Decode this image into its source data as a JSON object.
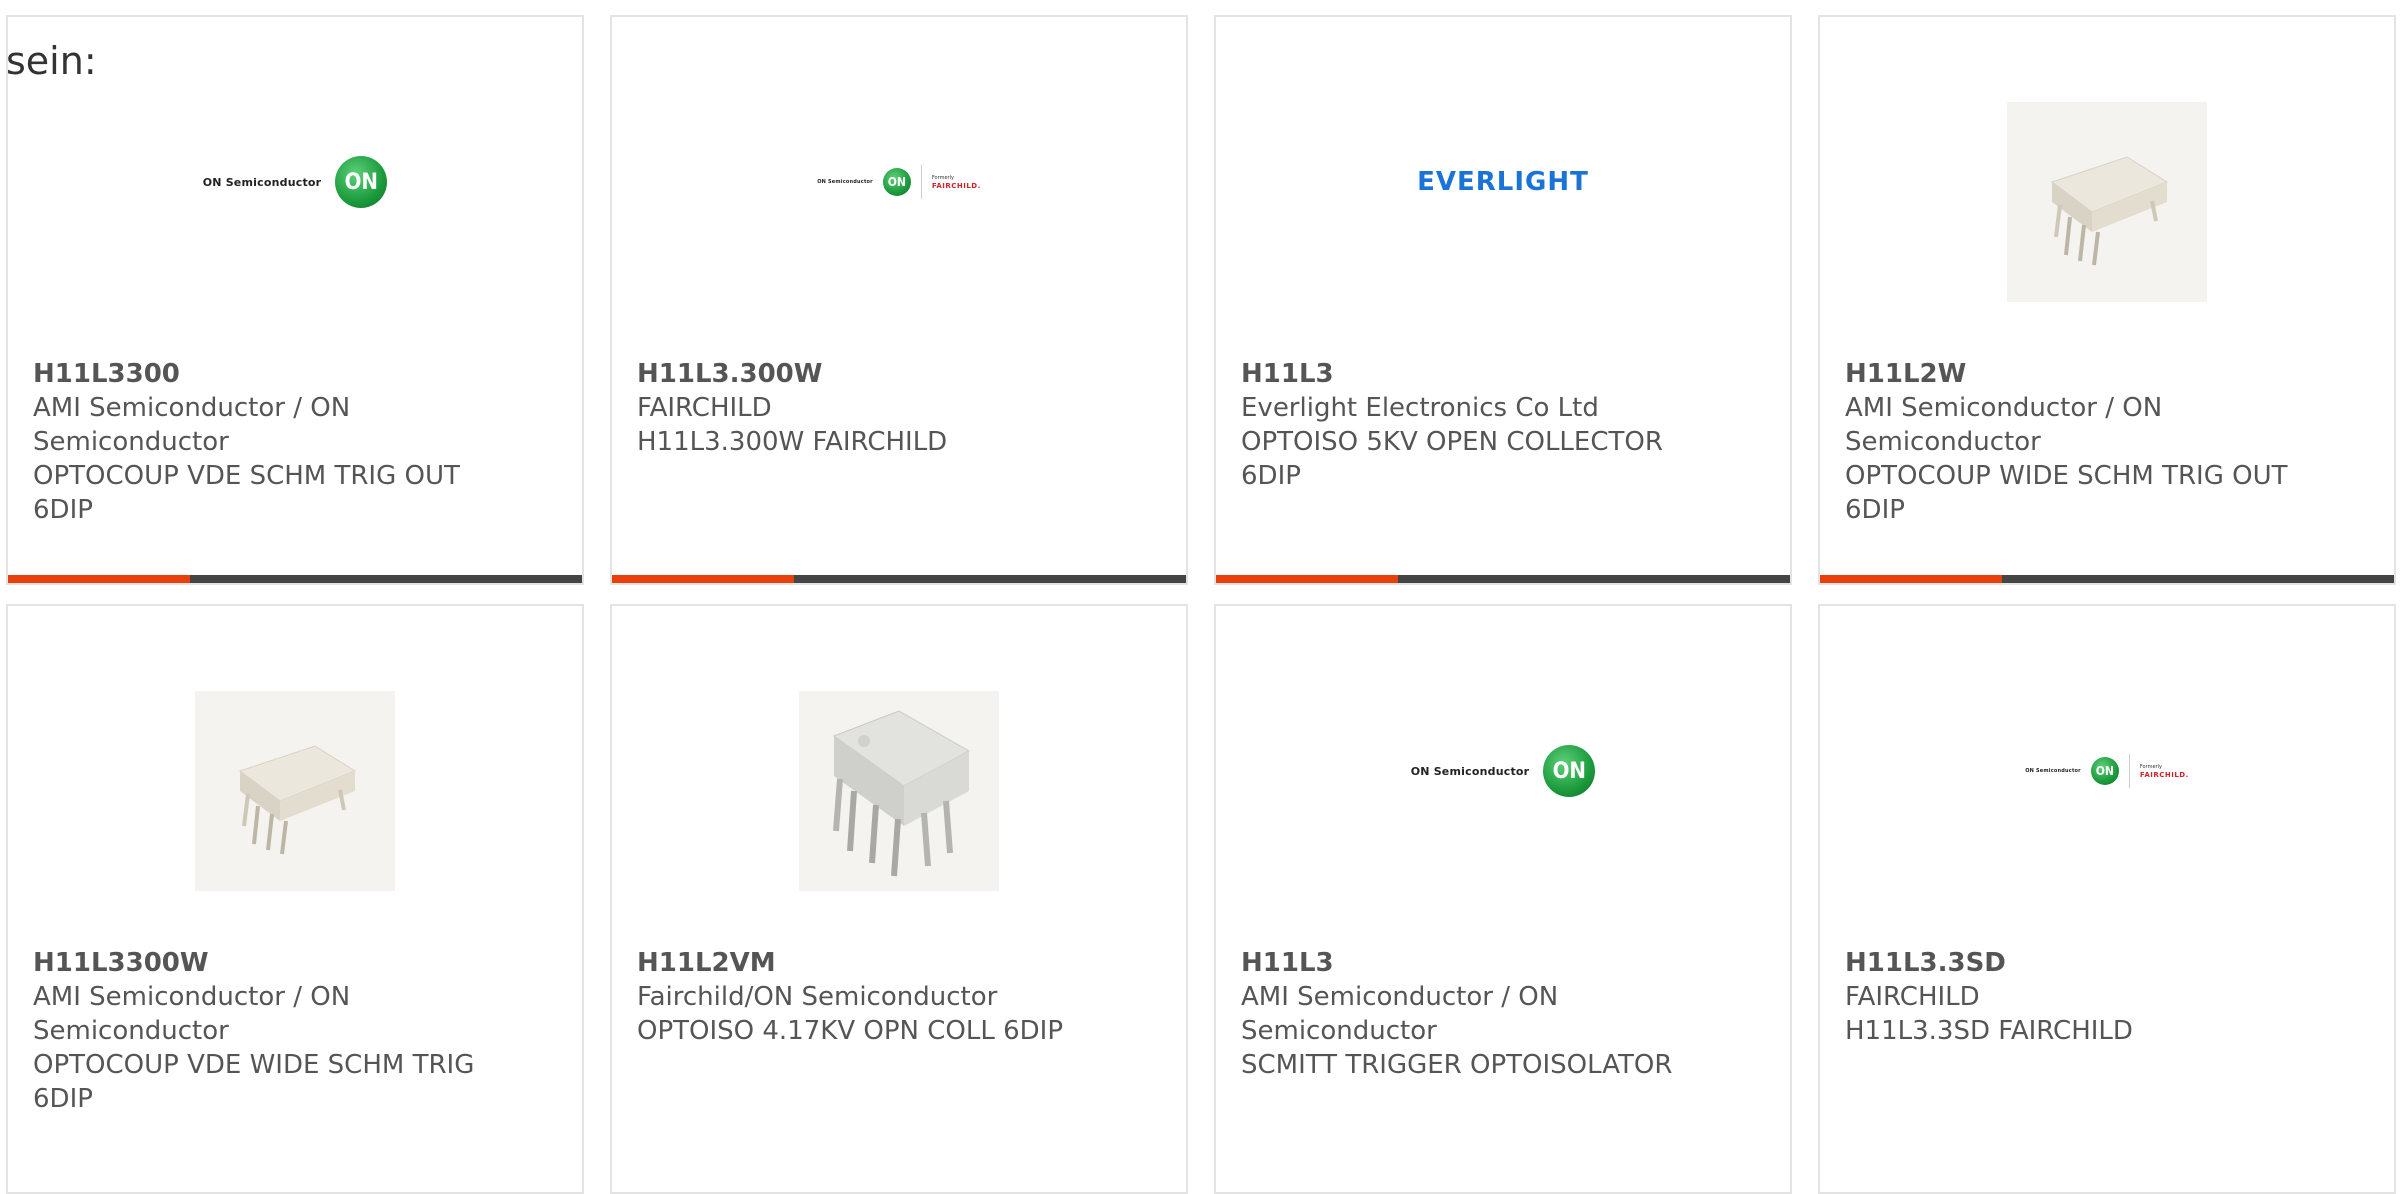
{
  "intro_text": "sein:",
  "colors": {
    "accent_bar": "#e8400c",
    "bar_dark": "#444444",
    "card_border": "#e3e3e3",
    "on_green": "#1b9a3c",
    "everlight_blue": "#1a73d6",
    "fairchild_red": "#d12328"
  },
  "logos": {
    "on_text": "ON Semiconductor",
    "on_circle": "ON",
    "fairchild_formerly": "Formerly",
    "fairchild_name": "FAIRCHILD.",
    "everlight": "EVERLIGHT"
  },
  "cards": [
    {
      "image": "on-semiconductor-logo",
      "part_number": "H11L3300",
      "manufacturer": "AMI Semiconductor / ON Semiconductor",
      "description": "OPTOCOUP VDE SCHM TRIG OUT 6DIP"
    },
    {
      "image": "on-fairchild-logo",
      "part_number": "H11L3.300W",
      "manufacturer": "FAIRCHILD",
      "description": "H11L3.300W FAIRCHILD"
    },
    {
      "image": "everlight-logo",
      "part_number": "H11L3",
      "manufacturer": "Everlight Electronics Co Ltd",
      "description": "OPTOISO 5KV OPEN COLLECTOR 6DIP"
    },
    {
      "image": "dip6-chip-photo",
      "part_number": "H11L2W",
      "manufacturer": "AMI Semiconductor / ON Semiconductor",
      "description": "OPTOCOUP WIDE SCHM TRIG OUT 6DIP"
    },
    {
      "image": "dip6-chip-photo",
      "part_number": "H11L3300W",
      "manufacturer": "AMI Semiconductor / ON Semiconductor",
      "description": "OPTOCOUP VDE WIDE SCHM TRIG 6DIP"
    },
    {
      "image": "dip6-chip-photo-large",
      "part_number": "H11L2VM",
      "manufacturer": "Fairchild/ON Semiconductor",
      "description": "OPTOISO 4.17KV OPN COLL 6DIP"
    },
    {
      "image": "on-semiconductor-logo",
      "part_number": "H11L3",
      "manufacturer": "AMI Semiconductor / ON Semiconductor",
      "description": "SCMITT TRIGGER OPTOISOLATOR"
    },
    {
      "image": "on-fairchild-logo",
      "part_number": "H11L3.3SD",
      "manufacturer": "FAIRCHILD",
      "description": "H11L3.3SD FAIRCHILD"
    }
  ]
}
